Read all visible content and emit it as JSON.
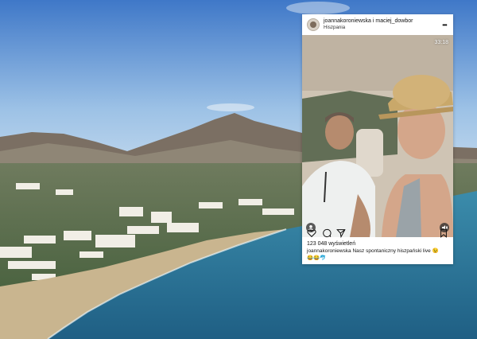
{
  "post": {
    "username": "joannakoroniewska i maciej_dowbor",
    "location": "Hiszpania",
    "timer": "33:18",
    "views": "123 048 wyświetleń",
    "caption_user": "joannakoroniewska",
    "caption_text": "Nasz spontaniczny hiszpański live 😉",
    "caption_emojis": "😂😂🐬"
  },
  "icons": {
    "more": "more-options-icon",
    "like": "heart-icon",
    "comment": "comment-icon",
    "share": "share-icon",
    "save": "bookmark-icon",
    "user_tag": "user-tag-icon",
    "mute": "mute-icon"
  },
  "colors": {
    "sky_top": "#3f78c8",
    "sea": "#2c6f93",
    "card_bg": "#ffffff"
  }
}
